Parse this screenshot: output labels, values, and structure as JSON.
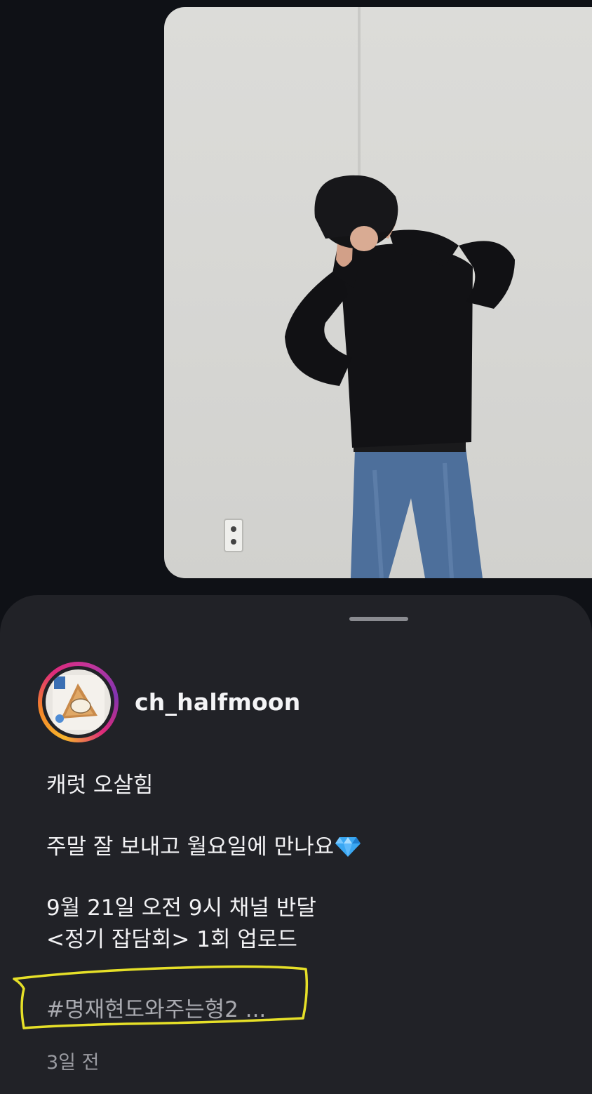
{
  "post": {
    "username": "ch_halfmoon",
    "caption_line1": "캐럿 오살힘",
    "caption_line2": "주말 잘 보내고 월요일에 만나요",
    "caption_line3": "9월 21일 오전 9시 채널 반달",
    "caption_line4": "<정기 잡담회> 1회 업로드",
    "hashtag_preview": "#명재현도와주는형2 ...",
    "time_ago": "3일 전"
  },
  "icons": {
    "gem": "gem-emoji-icon",
    "grabber": "sheet-grabber"
  },
  "colors": {
    "background": "#0f1116",
    "sheet": "#212227",
    "highlight_marker": "#e6e028"
  }
}
